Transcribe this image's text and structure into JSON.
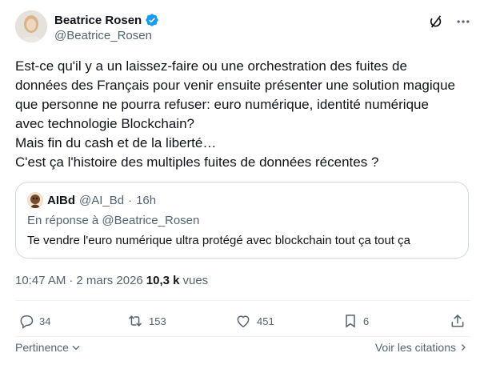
{
  "author": {
    "name": "Beatrice Rosen",
    "handle": "@Beatrice_Rosen",
    "verified": true,
    "icons": [
      "verified-badge-icon",
      "grok-icon",
      "more-icon"
    ]
  },
  "tweet": {
    "lines": [
      "Est-ce qu'il y a un laissez-faire ou une orchestration des fuites de",
      "données des Français pour venir ensuite présenter une solution magique",
      "que personne ne pourra refuser: euro numérique, identité numérique",
      "avec technologie Blockchain?",
      "Mais fin du cash et de la liberté…",
      "C'est ça l'histoire des multiples fuites de données récentes ?"
    ]
  },
  "quote": {
    "name": "AIBd",
    "handle": "@AI_Bd",
    "separator": "·",
    "time": "16h",
    "reply_to": "En réponse à @Beatrice_Rosen",
    "text": "Te vendre l'euro numérique ultra protégé avec blockchain tout ça tout ça"
  },
  "meta": {
    "time": "10:47 AM",
    "separator": "·",
    "date": "2 mars 2026",
    "views_count": "10,3 k",
    "views_label": "vues"
  },
  "actions": {
    "replies": "34",
    "reposts": "153",
    "likes": "451",
    "bookmarks": "6"
  },
  "footer": {
    "relevance": "Pertinence",
    "quotes": "Voir les citations"
  },
  "colors": {
    "text": "#0f1419",
    "secondary": "#536471",
    "border": "#cfd9de",
    "verified": "#1d9bf0"
  }
}
